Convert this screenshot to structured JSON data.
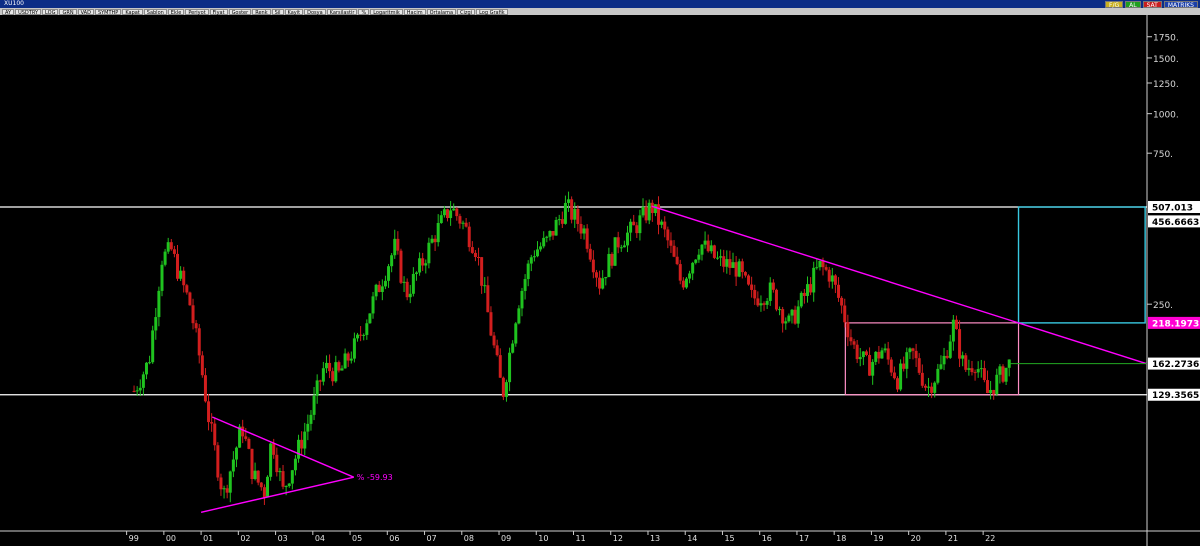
{
  "window": {
    "title": "XU100",
    "toolbar": [
      "AY",
      "USDTRY",
      "LOG",
      "GRN",
      "VAD",
      "SYMTHP",
      "Kapat",
      "Sablon",
      "Ekle",
      "Periyot",
      "Fiyat",
      "Goster",
      "Renk",
      "Sil",
      "Kayit",
      "Dosya",
      "Karsilastir",
      "%",
      "Logaritmik",
      "Hacim",
      "Ortalama",
      "Cizgi",
      "Log Grafik"
    ],
    "buttons": [
      {
        "label": "F/G",
        "color": "#c8b020"
      },
      {
        "label": "AL",
        "color": "#1e9e1e"
      },
      {
        "label": "SAT",
        "color": "#c81e1e"
      },
      {
        "label": "MATRIKS",
        "color": "#1b3fa8"
      }
    ]
  },
  "chart_data": {
    "type": "candlestick",
    "scale": "log",
    "ylim": [
      48,
      2050
    ],
    "y_ticks": [
      250,
      750,
      1000,
      1250,
      1500,
      1750
    ],
    "x_ticks": [
      "99",
      "00",
      "01",
      "02",
      "03",
      "04",
      "05",
      "06",
      "07",
      "08",
      "09",
      "10",
      "11",
      "12",
      "13",
      "14",
      "15",
      "16",
      "17",
      "18",
      "19",
      "20",
      "21",
      "22"
    ],
    "colors": {
      "up": "#1fc31f",
      "down": "#d21e1e",
      "trend": "#ff00ff",
      "level": "#ffffff",
      "range_box": "#ff8ec6",
      "target_box": "#38c8e0",
      "projection": "#22aa22"
    },
    "levels": [
      {
        "label": "507.013",
        "value": 507.013,
        "style": "white"
      },
      {
        "label": "456.6663",
        "value": 456.6663,
        "style": "white"
      },
      {
        "label": "218.1973",
        "value": 218.1973,
        "style": "magenta"
      },
      {
        "label": "162.2736",
        "value": 162.2736,
        "style": "white"
      },
      {
        "label": "129.3565",
        "value": 129.3565,
        "style": "white"
      }
    ],
    "triangle_annotation": "% -59.93",
    "price_path": [
      {
        "x": 1999.2,
        "y": 133
      },
      {
        "x": 1999.6,
        "y": 165
      },
      {
        "x": 1999.95,
        "y": 350
      },
      {
        "x": 2000.2,
        "y": 370
      },
      {
        "x": 2000.45,
        "y": 300
      },
      {
        "x": 2000.7,
        "y": 250
      },
      {
        "x": 2001.0,
        "y": 160
      },
      {
        "x": 2001.2,
        "y": 110
      },
      {
        "x": 2001.4,
        "y": 82
      },
      {
        "x": 2001.6,
        "y": 62
      },
      {
        "x": 2001.8,
        "y": 76
      },
      {
        "x": 2002.1,
        "y": 103
      },
      {
        "x": 2002.4,
        "y": 72
      },
      {
        "x": 2002.7,
        "y": 64
      },
      {
        "x": 2002.9,
        "y": 95
      },
      {
        "x": 2003.2,
        "y": 64
      },
      {
        "x": 2003.5,
        "y": 80
      },
      {
        "x": 2003.9,
        "y": 108
      },
      {
        "x": 2004.3,
        "y": 158
      },
      {
        "x": 2004.7,
        "y": 150
      },
      {
        "x": 2005.2,
        "y": 190
      },
      {
        "x": 2005.7,
        "y": 270
      },
      {
        "x": 2006.2,
        "y": 378
      },
      {
        "x": 2006.5,
        "y": 268
      },
      {
        "x": 2006.9,
        "y": 330
      },
      {
        "x": 2007.3,
        "y": 420
      },
      {
        "x": 2007.7,
        "y": 507
      },
      {
        "x": 2008.0,
        "y": 455
      },
      {
        "x": 2008.4,
        "y": 370
      },
      {
        "x": 2008.8,
        "y": 200
      },
      {
        "x": 2009.1,
        "y": 129
      },
      {
        "x": 2009.5,
        "y": 250
      },
      {
        "x": 2009.9,
        "y": 365
      },
      {
        "x": 2010.3,
        "y": 395
      },
      {
        "x": 2010.8,
        "y": 510
      },
      {
        "x": 2011.3,
        "y": 425
      },
      {
        "x": 2011.7,
        "y": 292
      },
      {
        "x": 2012.2,
        "y": 395
      },
      {
        "x": 2012.6,
        "y": 430
      },
      {
        "x": 2013.1,
        "y": 510
      },
      {
        "x": 2013.5,
        "y": 405
      },
      {
        "x": 2013.9,
        "y": 290
      },
      {
        "x": 2014.4,
        "y": 390
      },
      {
        "x": 2014.9,
        "y": 340
      },
      {
        "x": 2015.4,
        "y": 325
      },
      {
        "x": 2015.8,
        "y": 260
      },
      {
        "x": 2016.3,
        "y": 275
      },
      {
        "x": 2016.8,
        "y": 215
      },
      {
        "x": 2017.2,
        "y": 265
      },
      {
        "x": 2017.6,
        "y": 330
      },
      {
        "x": 2017.9,
        "y": 310
      },
      {
        "x": 2018.2,
        "y": 245
      },
      {
        "x": 2018.5,
        "y": 185
      },
      {
        "x": 2018.9,
        "y": 158
      },
      {
        "x": 2019.3,
        "y": 180
      },
      {
        "x": 2019.7,
        "y": 145
      },
      {
        "x": 2020.1,
        "y": 175
      },
      {
        "x": 2020.5,
        "y": 135
      },
      {
        "x": 2020.9,
        "y": 160
      },
      {
        "x": 2021.2,
        "y": 215
      },
      {
        "x": 2021.5,
        "y": 155
      },
      {
        "x": 2021.8,
        "y": 165
      },
      {
        "x": 2022.1,
        "y": 130
      },
      {
        "x": 2022.4,
        "y": 145
      },
      {
        "x": 2022.7,
        "y": 162
      }
    ],
    "trendlines": [
      {
        "from": {
          "x": 2013.1,
          "y": 510
        },
        "to": {
          "x": 2026.4,
          "y": 162
        }
      },
      {
        "from": {
          "x": 2001.3,
          "y": 110
        },
        "to": {
          "x": 2005.1,
          "y": 71
        }
      },
      {
        "from": {
          "x": 2001.0,
          "y": 55
        },
        "to": {
          "x": 2005.1,
          "y": 71
        }
      }
    ],
    "horizontal_lines": [
      {
        "y": 507.013,
        "x_from": 1995.6,
        "x_to": 2026.4
      },
      {
        "y": 129.3565,
        "x_from": 1995.6,
        "x_to": 2026.4
      }
    ],
    "range_box": {
      "x_from": 2018.3,
      "x_to": 2022.95,
      "y_from": 129.3565,
      "y_to": 218.1973
    },
    "target_box": {
      "x_from": 2022.95,
      "x_to": 2026.35,
      "y_from": 218.1973,
      "y_to": 507.013
    },
    "projection_line": {
      "y": 162.2736,
      "x_from": 2022.7,
      "x_to": 2026.4
    }
  }
}
